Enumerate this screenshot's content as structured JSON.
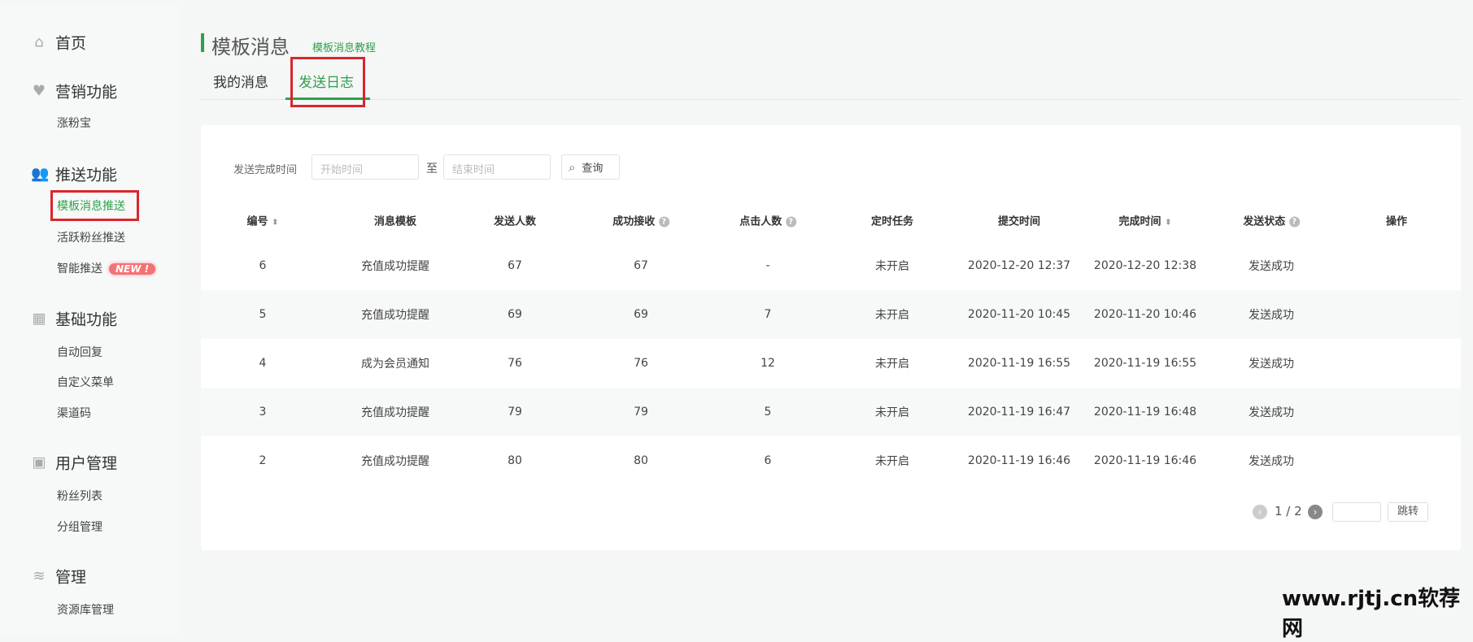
{
  "sidebar": {
    "groups": [
      {
        "label": "首页",
        "icon": "home-icon",
        "items": []
      },
      {
        "label": "营销功能",
        "icon": "heart-plus-icon",
        "items": [
          "涨粉宝"
        ]
      },
      {
        "label": "推送功能",
        "icon": "users-icon",
        "items": [
          "模板消息推送",
          "活跃粉丝推送",
          "智能推送"
        ]
      },
      {
        "label": "基础功能",
        "icon": "grid-icon",
        "items": [
          "自动回复",
          "自定义菜单",
          "渠道码"
        ]
      },
      {
        "label": "用户管理",
        "icon": "user-card-icon",
        "items": [
          "粉丝列表",
          "分组管理"
        ]
      },
      {
        "label": "管理",
        "icon": "layers-icon",
        "items": [
          "资源库管理"
        ]
      }
    ],
    "new_badge": "NEW !"
  },
  "header": {
    "title": "模板消息",
    "tutorial_link": "模板消息教程",
    "tabs": [
      "我的消息",
      "发送日志"
    ],
    "active_tab": "发送日志"
  },
  "filter": {
    "label": "发送完成时间",
    "start_placeholder": "开始时间",
    "to": "至",
    "end_placeholder": "结束时间",
    "query": "查询"
  },
  "table": {
    "columns": [
      "编号",
      "消息模板",
      "发送人数",
      "成功接收",
      "点击人数",
      "定时任务",
      "提交时间",
      "完成时间",
      "发送状态",
      "操作"
    ],
    "rows": [
      [
        "6",
        "充值成功提醒",
        "67",
        "67",
        "-",
        "未开启",
        "2020-12-20 12:37",
        "2020-12-20 12:38",
        "发送成功"
      ],
      [
        "5",
        "充值成功提醒",
        "69",
        "69",
        "7",
        "未开启",
        "2020-11-20 10:45",
        "2020-11-20 10:46",
        "发送成功"
      ],
      [
        "4",
        "成为会员通知",
        "76",
        "76",
        "12",
        "未开启",
        "2020-11-19 16:55",
        "2020-11-19 16:55",
        "发送成功"
      ],
      [
        "3",
        "充值成功提醒",
        "79",
        "79",
        "5",
        "未开启",
        "2020-11-19 16:47",
        "2020-11-19 16:48",
        "发送成功"
      ],
      [
        "2",
        "充值成功提醒",
        "80",
        "80",
        "6",
        "未开启",
        "2020-11-19 16:46",
        "2020-11-19 16:46",
        "发送成功"
      ]
    ]
  },
  "pagination": {
    "page": "1 / 2",
    "jump": "跳转"
  },
  "watermark": "www.rjtj.cn软荐网",
  "colors": {
    "accent": "#2fa14b",
    "highlight": "#d9262c"
  }
}
